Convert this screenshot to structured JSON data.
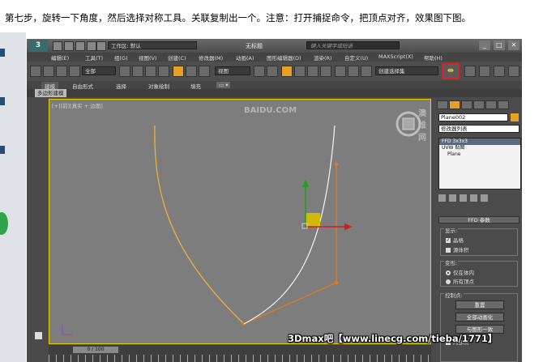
{
  "caption": "第七步，旋转一下角度，然后选择对称工具。关联复制出一个。注意：打开捕捉命令，把顶点对齐，效果图下图。",
  "app": {
    "logo": "3",
    "workspace": "工作区: 默认",
    "window_title": "无标题",
    "search_placeholder": "键入关键字或短语",
    "window_buttons": [
      "_",
      "□",
      "✕"
    ]
  },
  "menu": [
    "编辑(E)",
    "工具(T)",
    "组(G)",
    "视图(V)",
    "创建(C)",
    "修改器(M)",
    "动画(A)",
    "图形编辑器(D)",
    "渲染(R)",
    "自定义(U)",
    "MAXScript(X)",
    "帮助(H)"
  ],
  "toolbar": {
    "selection_filter": "全部",
    "ref_coord": "视图",
    "named_selection": "创建选择集",
    "mirror_icon": "mirror-icon"
  },
  "ribbon": {
    "tabs": [
      "建模",
      "自由形式",
      "选择",
      "对象绘制",
      "填充"
    ],
    "sub_label": "多边形建模"
  },
  "viewport": {
    "label": "[+][前][真实 + 边面]",
    "highlight_color": "#e6d200"
  },
  "command_panel": {
    "object_name": "Plane002",
    "modifier_list": "修改器列表",
    "stack": [
      "FFD 3x3x3",
      "UVW 贴图",
      "Plane"
    ],
    "rollout_title": "FFD 参数",
    "display_group": "显示:",
    "display_options": [
      "晶格",
      "源体积"
    ],
    "deform_group": "变形:",
    "deform_options": [
      "仅在体内",
      "所有顶点"
    ],
    "control_group": "控制点:",
    "buttons": [
      "重置",
      "全部动画化",
      "与图形一致"
    ],
    "inner_point": "内部点"
  },
  "timeline": {
    "frame": "0 / 100"
  },
  "watermark": "3Dmax吧【www.linecg.com/tieba/1771】",
  "watermark_logo": "BAIDU.COM",
  "watermark_logo2": "澳维网"
}
